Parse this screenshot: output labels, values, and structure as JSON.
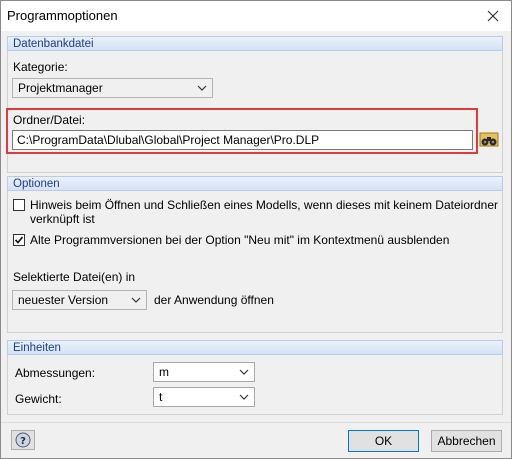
{
  "window": {
    "title": "Programmoptionen",
    "close_icon": "close-icon"
  },
  "database": {
    "header": "Datenbankdatei",
    "category_label": "Kategorie:",
    "category_value": "Projektmanager",
    "folder_label": "Ordner/Datei:",
    "folder_path": "C:\\ProgramData\\Dlubal\\Global\\Project Manager\\Pro.DLP",
    "browse_icon": "binoculars-icon"
  },
  "options": {
    "header": "Optionen",
    "hint_checkbox": {
      "label_line1": "Hinweis beim Öffnen und Schließen eines Modells, wenn dieses mit keinem Dateiordner",
      "label_line2": "verknüpft ist",
      "checked": false
    },
    "hide_checkbox": {
      "label": "Alte Programmversionen bei der Option \"Neu mit\" im Kontextmenü ausblenden",
      "checked": true
    },
    "selected_files_label": "Selektierte Datei(en) in",
    "version_value": "neuester Version",
    "open_with_label": "der Anwendung öffnen"
  },
  "units": {
    "header": "Einheiten",
    "dimensions_label": "Abmessungen:",
    "dimensions_value": "m",
    "weight_label": "Gewicht:",
    "weight_value": "t"
  },
  "footer": {
    "help_icon": "help-icon",
    "ok_label": "OK",
    "cancel_label": "Abbrechen"
  }
}
